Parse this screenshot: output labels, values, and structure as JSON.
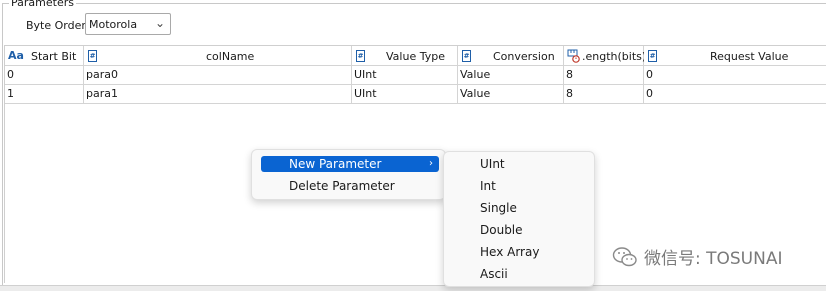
{
  "params": {
    "title": "Parameters",
    "byte_order_label": "Byte Order",
    "byte_order_value": "Motorola"
  },
  "grid": {
    "columns": [
      "Start Bit",
      "colName",
      "Value Type",
      "Conversion",
      ".ength(bits)",
      "Request Value"
    ],
    "rows": [
      [
        "0",
        "para0",
        "UInt",
        "Value",
        "8",
        "0"
      ],
      [
        "1",
        "para1",
        "UInt",
        "Value",
        "8",
        "0"
      ]
    ]
  },
  "context_menu": {
    "items": [
      "New Parameter",
      "Delete Parameter"
    ],
    "highlighted": "New Parameter"
  },
  "submenu": {
    "items": [
      "UInt",
      "Int",
      "Single",
      "Double",
      "Hex Array",
      "Ascii"
    ]
  },
  "icons": {
    "string_col": "hash-icon",
    "text_col": "aa-icon",
    "length_col": "ruler-icon"
  },
  "colors": {
    "highlight": "#0a64d2",
    "icon_blue": "#1f5fa8"
  },
  "watermark": "微信号: TOSUNAI"
}
